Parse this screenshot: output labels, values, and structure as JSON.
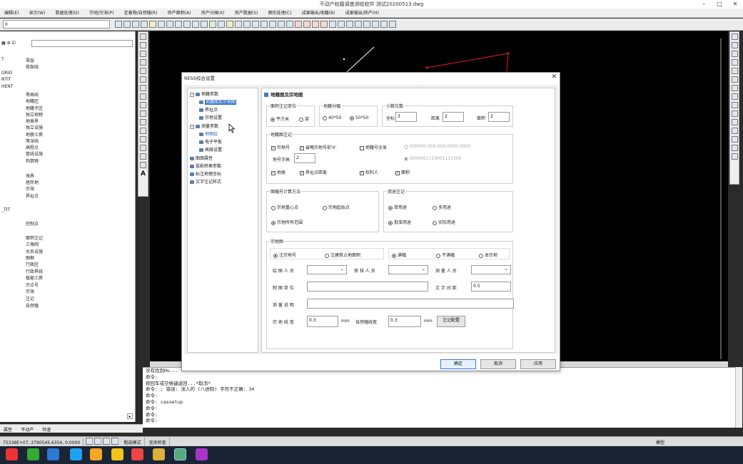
{
  "window": {
    "title": "不动产权籍调查测绘软件     测试20200513.dwg"
  },
  "menu": [
    "编辑(E)",
    "显示(W)",
    "数据处理(D)",
    "宗地/宗海(P)",
    "定着物/自然幢(R)",
    "房产面积(A)",
    "房产分摊(X)",
    "房产数据(S)",
    "图形处理(C)",
    "成果输出/地籍(B)",
    "成果输出/房产(H)"
  ],
  "left_panel": {
    "layer_value": "0",
    "items": [
      {
        "code": "T",
        "name": "零层"
      },
      {
        "code": "",
        "name": "骨架线"
      },
      {
        "code": "GRID",
        "name": ""
      },
      {
        "code": "NTIT",
        "name": ""
      },
      {
        "code": "HENT",
        "name": ""
      },
      {
        "code": "",
        "name": "等高线"
      },
      {
        "code": "",
        "name": "地籍区"
      },
      {
        "code": "",
        "name": "地籍子区"
      },
      {
        "code": "",
        "name": "独立地物"
      },
      {
        "code": "",
        "name": "地类界"
      },
      {
        "code": "",
        "name": "独立设施"
      },
      {
        "code": "",
        "name": "地貌土质"
      },
      {
        "code": "",
        "name": "等深线"
      },
      {
        "code": "",
        "name": "高程点"
      },
      {
        "code": "",
        "name": "管线设施"
      },
      {
        "code": "",
        "name": "构筑物"
      },
      {
        "code": "",
        "name": "境界"
      },
      {
        "code": "",
        "name": "居民地"
      },
      {
        "code": "",
        "name": "宗海"
      },
      {
        "code": "",
        "name": "界址点"
      },
      {
        "code": "_TIT",
        "name": ""
      },
      {
        "code": "",
        "name": "控制点"
      },
      {
        "code": "",
        "name": "面积注记"
      },
      {
        "code": "",
        "name": "三角网"
      },
      {
        "code": "",
        "name": "水系设施"
      },
      {
        "code": "",
        "name": "图框"
      },
      {
        "code": "",
        "name": "行政区"
      },
      {
        "code": "",
        "name": "行政界线"
      },
      {
        "code": "",
        "name": "植被土质"
      },
      {
        "code": "",
        "name": "宗点号"
      },
      {
        "code": "",
        "name": "宗海"
      },
      {
        "code": "",
        "name": "注记"
      },
      {
        "code": "",
        "name": "自然幢"
      }
    ],
    "bottom_tabs": [
      "属性",
      "不动产",
      "检查"
    ]
  },
  "command": {
    "lines": [
      "没有找到Hu...",
      "命令:",
      "按回车或空格键返回...*取消*",
      "命令: ; 错误: 读入的 (八进制) 字符不正确: 34",
      "命令:",
      "命令: cassetup",
      "命令:",
      "命令:",
      "命令:"
    ]
  },
  "status": {
    "coords": "75338E+07, 2790545.6354, 0.0000",
    "items": [
      "粗选模式",
      "宜命检查"
    ],
    "right": [
      "模型"
    ]
  },
  "dialog": {
    "title": "RESS综合设置",
    "tree": [
      {
        "label": "地籍参数",
        "level": 0,
        "expanded": true
      },
      {
        "label": "地籍图及宗地图",
        "level": 1,
        "selected": true
      },
      {
        "label": "界址点",
        "level": 1
      },
      {
        "label": "宗地设置",
        "level": 1
      },
      {
        "label": "测量参数",
        "level": 0,
        "expanded": true
      },
      {
        "label": "地物绘",
        "level": 1,
        "selected2": true
      },
      {
        "label": "电子平板",
        "level": 1
      },
      {
        "label": "高级设置",
        "level": 1
      },
      {
        "label": "图廓属性",
        "level": 0
      },
      {
        "label": "投影转换参数",
        "level": 0
      },
      {
        "label": "标注地理坐标",
        "level": 0
      },
      {
        "label": "文字注记样式",
        "level": 0
      }
    ],
    "panel_title": "地籍图及宗地图",
    "area_unit": {
      "title": "面积注记单位",
      "options": [
        "平方米",
        "亩"
      ],
      "selected": 0
    },
    "sheet": {
      "title": "地籍分幅",
      "options": [
        "40*50",
        "50*50"
      ],
      "selected": 1
    },
    "decimals": {
      "title": "小数位数",
      "coord_label": "坐标",
      "coord": "3",
      "dist_label": "距离",
      "dist": "2",
      "area_label": "面积",
      "area": "2"
    },
    "cadastral_note": {
      "title": "地籍图注记",
      "cb_parcel_no": "宗地号",
      "cb_omit": "省略宗地号前'0'",
      "cb_full": "地籍号全显",
      "opt1": "000000-000-000-0000-(000)",
      "opt2": "0000001110001111000",
      "digits_label": "地号字高",
      "digits": "2",
      "cb_landtype": "地类",
      "cb_boundary_dist": "界址点距离",
      "cb_owner": "权利人",
      "cb_area": "面积"
    },
    "sheet_calc": {
      "title": "图幅号计算方法",
      "options": [
        "宗地重心点",
        "宗地起始点",
        "宗地所有范围"
      ],
      "selected": 2
    },
    "usage": {
      "title": "用途注记",
      "options": [
        "单用途",
        "多用途",
        "批准用途",
        "实际用途"
      ],
      "selected": [
        0,
        2
      ]
    },
    "parcel_map": {
      "title": "宗地图",
      "opt_a": [
        "注宗地号",
        "注建筑占地面积"
      ],
      "opt_a_sel": 0,
      "opt_b": [
        "满幅",
        "不满幅",
        "本宗地"
      ],
      "opt_b_sel": 0,
      "drawer_label": "绘 图 人 员",
      "checker_label": "审 核 人 员",
      "surveyor_label": "测 量 人 员",
      "org_label": "制 图 单 位",
      "spacing_label": "文 字 间 距",
      "spacing": "0.5",
      "note_label": "测 量 说 明",
      "parcel_line_label": "宗 地 线 宽",
      "parcel_line": "0.3",
      "unit_mm": "mm",
      "bld_line_label": "自然幢线宽",
      "bld_line": "0.3",
      "config_btn": "注记配置"
    },
    "buttons": {
      "ok": "确定",
      "cancel": "取消",
      "apply": "应用"
    }
  }
}
